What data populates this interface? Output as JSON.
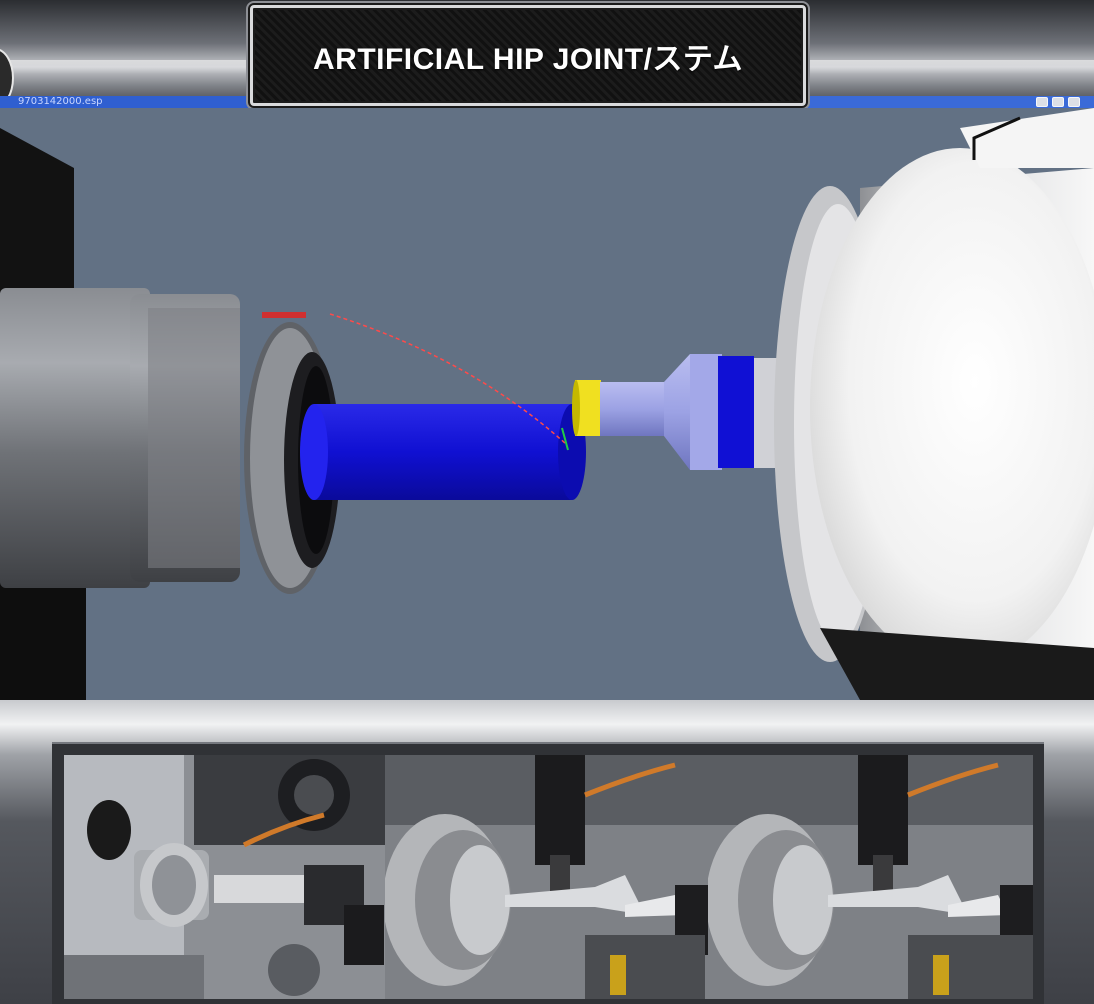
{
  "title": "ARTIFICIAL HIP JOINT/ステム",
  "window": {
    "caption": "9703142000.esp"
  },
  "colors": {
    "viewport_background": "#627184",
    "workpiece": "#1414d8",
    "collet_ring": "#f0e020",
    "tailstock": "#9aa0e6",
    "toolpath": "#ff4040"
  },
  "photos": [
    {
      "name": "lathe-overview-photo"
    },
    {
      "name": "stem-machining-photo-1"
    },
    {
      "name": "stem-machining-photo-2"
    }
  ]
}
